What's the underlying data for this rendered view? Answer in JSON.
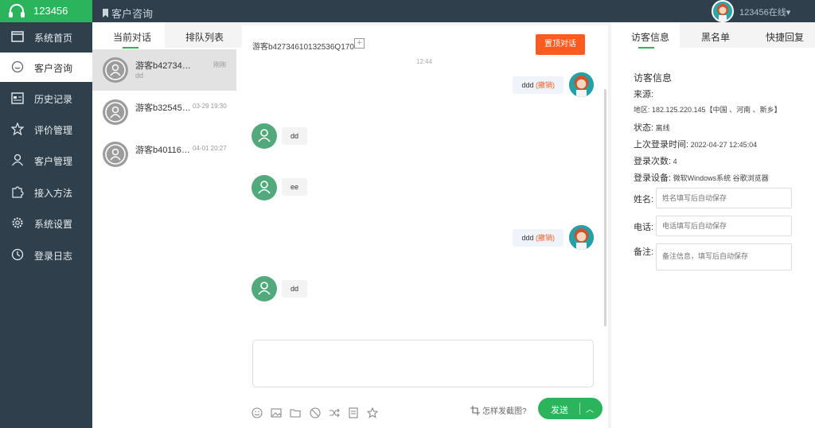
{
  "app": {
    "name": "123456"
  },
  "header": {
    "page_title": "客户咨询",
    "user_status": "123456在线"
  },
  "sidebar": {
    "items": [
      {
        "label": "系统首页",
        "icon": "monitor-icon"
      },
      {
        "label": "客户咨询",
        "icon": "chat-bubble-icon"
      },
      {
        "label": "历史记录",
        "icon": "calendar-icon"
      },
      {
        "label": "评价管理",
        "icon": "star-icon"
      },
      {
        "label": "客户管理",
        "icon": "user-icon"
      },
      {
        "label": "接入方法",
        "icon": "puzzle-icon"
      },
      {
        "label": "系统设置",
        "icon": "gear-icon"
      },
      {
        "label": "登录日志",
        "icon": "clock-icon"
      }
    ]
  },
  "conversation_panel": {
    "tabs": [
      {
        "label": "当前对话"
      },
      {
        "label": "排队列表"
      }
    ],
    "conversations": [
      {
        "name": "游客b4273461...",
        "time": "刚刚",
        "preview": "dd"
      },
      {
        "name": "游客b3254566...",
        "time": "03-29 19:30",
        "preview": ""
      },
      {
        "name": "游客b4011602...",
        "time": "04-01 20:27",
        "preview": ""
      }
    ]
  },
  "chat": {
    "visitor_id": "游客b42734610132536Q170",
    "pin_button": "置顶对话",
    "timestamp": "12:44",
    "messages": [
      {
        "from": "agent",
        "text": "ddd",
        "revoke": "(撤销)"
      },
      {
        "from": "visitor",
        "text": "dd"
      },
      {
        "from": "visitor",
        "text": "ee"
      },
      {
        "from": "agent",
        "text": "ddd",
        "revoke": "(撤销)"
      },
      {
        "from": "visitor",
        "text": "dd"
      }
    ],
    "screenshot_hint": "怎样发截图?",
    "send_button": "发送",
    "toolbar_icons": [
      "smiley-icon",
      "image-icon",
      "folder-icon",
      "block-icon",
      "transfer-icon",
      "invoice-icon",
      "star-outline-icon"
    ]
  },
  "right_panel": {
    "tabs": [
      {
        "label": "访客信息"
      },
      {
        "label": "黑名单"
      },
      {
        "label": "快捷回复"
      }
    ],
    "title": "访客信息",
    "source_label": "来源:",
    "region": "地区: 182.125.220.145【中国 、河南 、新乡】",
    "status_label": "状态:",
    "status_value": "离线",
    "last_login_label": "上次登录时间:",
    "last_login_value": "2022-04-27 12:45:04",
    "login_count_label": "登录次数:",
    "login_count_value": "4",
    "device_label": "登录设备:",
    "device_value": "微软Windows系统 谷歌浏览器",
    "fields": [
      {
        "label": "姓名:",
        "placeholder": "姓名填写后自动保存"
      },
      {
        "label": "电话:",
        "placeholder": "电话填写后自动保存"
      },
      {
        "label": "备注:",
        "placeholder": "备注信息，填写后自动保存"
      }
    ]
  },
  "colors": {
    "brand": "#2bb45c",
    "sidebar": "#2f3f4c",
    "accent": "#ff5a1f",
    "visitor_avatar": "#53a97c"
  }
}
